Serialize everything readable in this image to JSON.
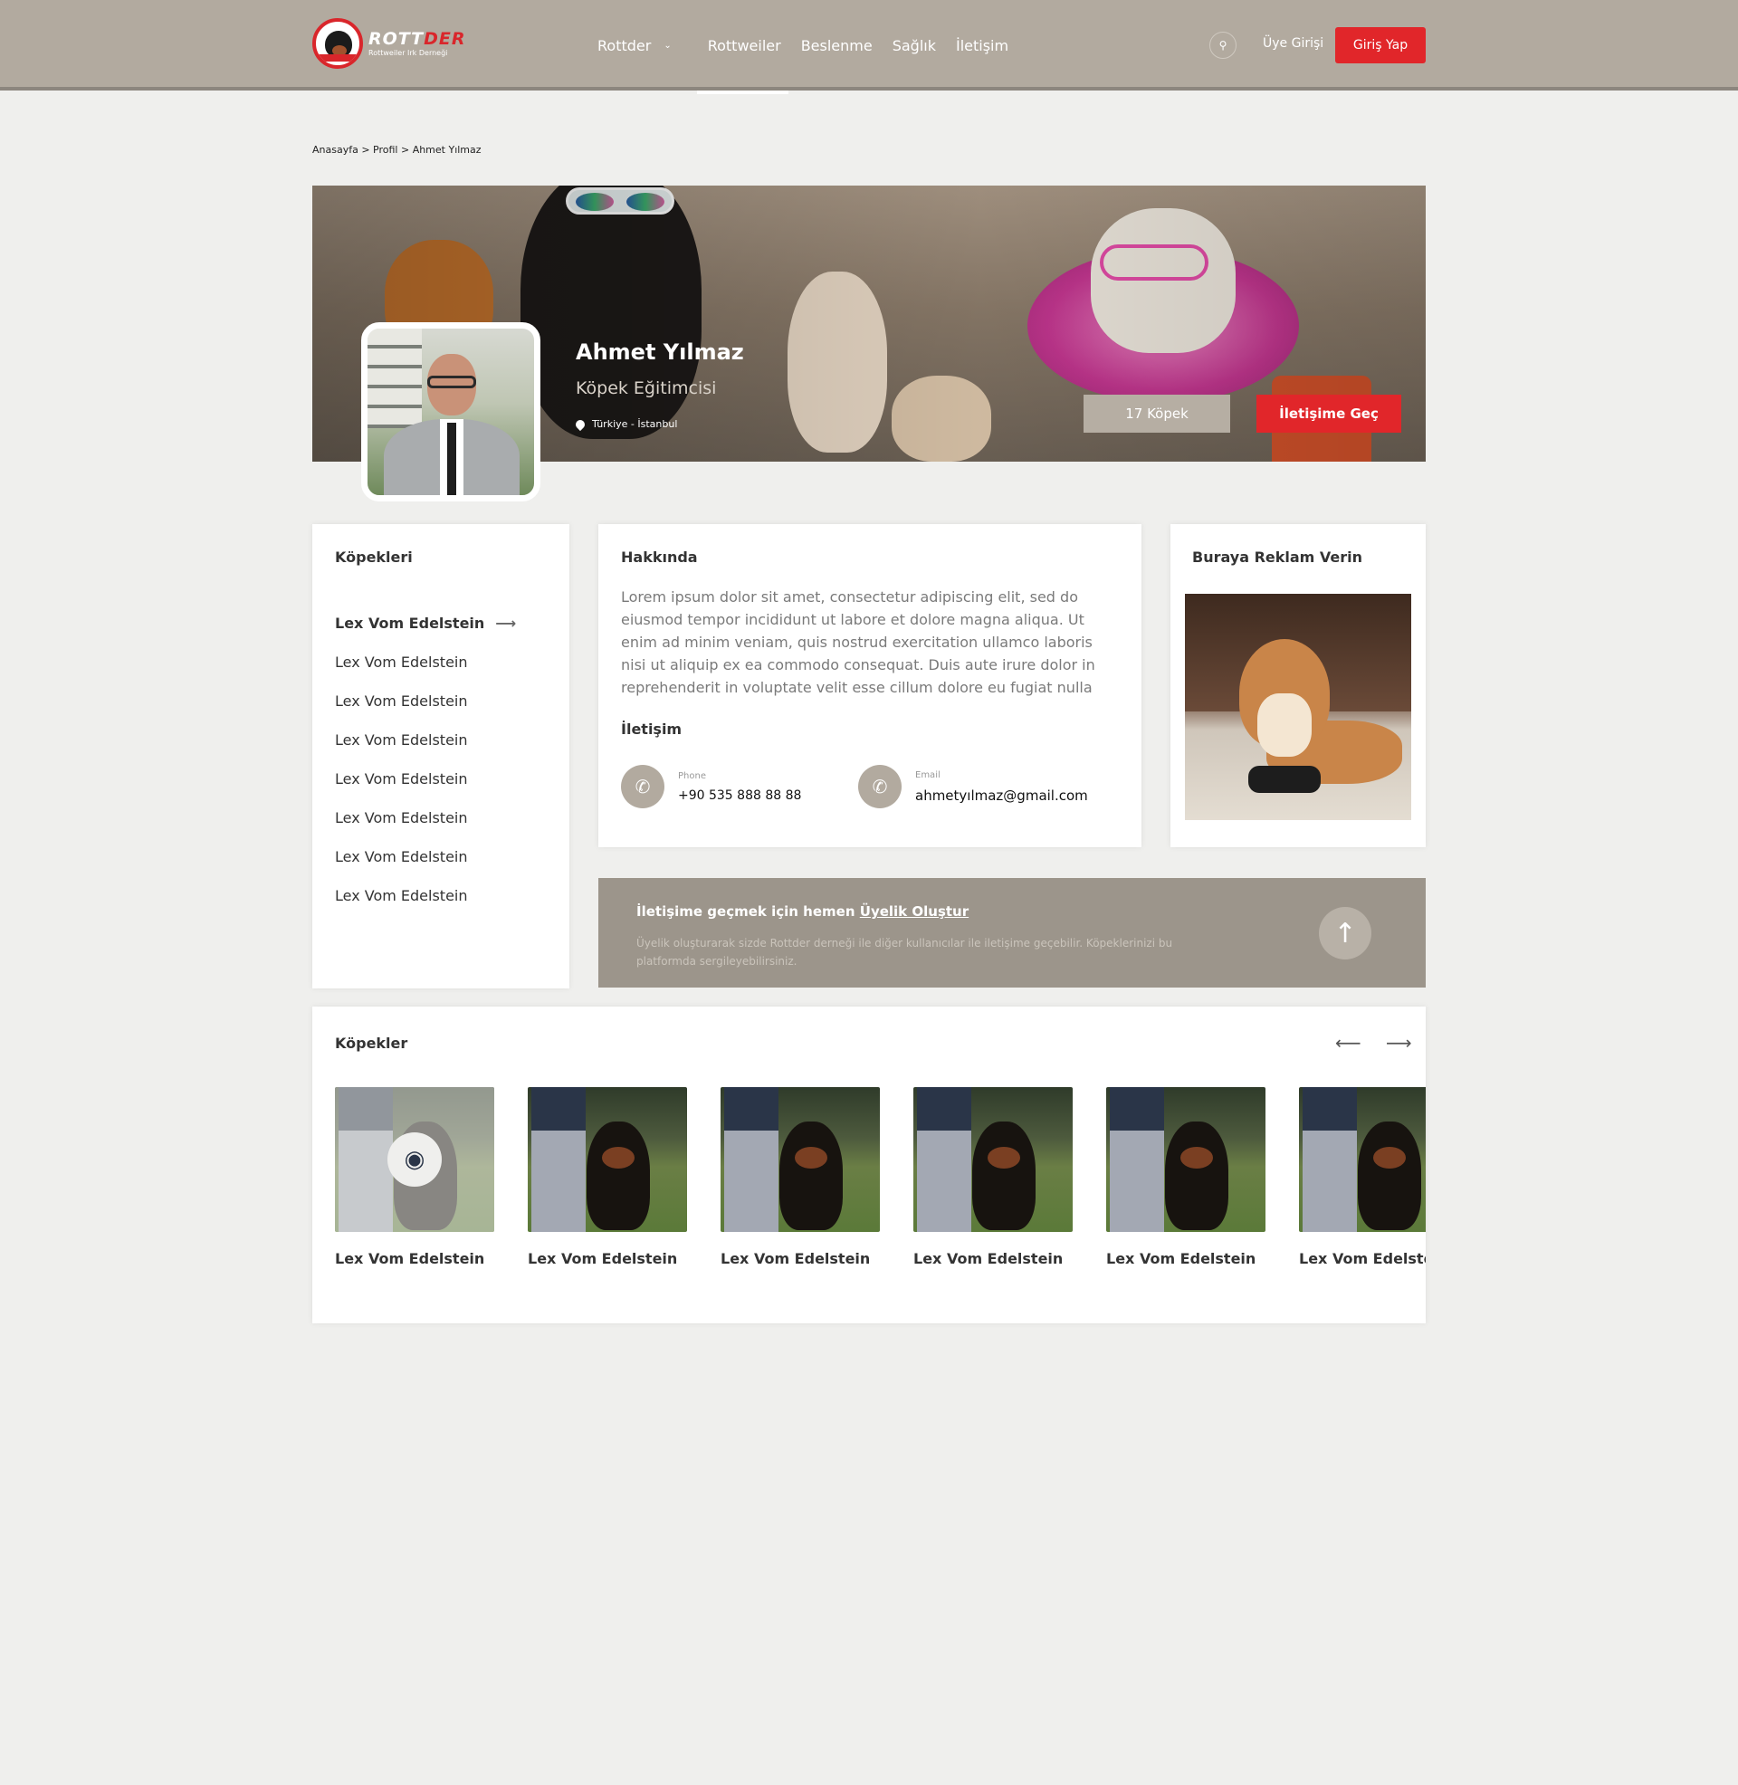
{
  "header": {
    "logo_name_a": "ROTT",
    "logo_name_b": "DER",
    "logo_sub": "Rottweiler Irk Derneği",
    "nav": [
      {
        "label": "Rottder",
        "chevron": "chevron-down-icon"
      },
      {
        "label": "Rottweiler"
      },
      {
        "label": "Beslenme"
      },
      {
        "label": "Sağlık"
      },
      {
        "label": "İletişim"
      }
    ],
    "active_nav": "Rottweiler",
    "search_icon": "search-icon",
    "member_login": "Üye Girişi",
    "login_button": "Giriş Yap"
  },
  "breadcrumb": "Anasayfa > Profil > Ahmet Yılmaz",
  "profile": {
    "name": "Ahmet Yılmaz",
    "title": "Köpek Eğitimcisi",
    "location": "Türkiye - İstanbul",
    "dogs_count_button": "17 Köpek",
    "contact_button": "İletişime Geç"
  },
  "dogs_list": {
    "title": "Köpekleri",
    "items": [
      "Lex Vom Edelstein",
      "Lex Vom Edelstein",
      "Lex Vom Edelstein",
      "Lex Vom Edelstein",
      "Lex Vom Edelstein",
      "Lex Vom Edelstein",
      "Lex Vom Edelstein",
      "Lex Vom Edelstein"
    ],
    "active_arrow": "⟶"
  },
  "about": {
    "title": "Hakkında",
    "text": "Lorem ipsum dolor sit amet, consectetur adipiscing elit, sed do eiusmod tempor incididunt ut labore et dolore magna aliqua. Ut enim ad minim veniam, quis nostrud exercitation ullamco laboris nisi ut aliquip ex ea commodo consequat. Duis aute irure dolor in reprehenderit in voluptate velit esse cillum dolore eu fugiat nulla",
    "contact_title": "İletişim",
    "phone_label": "Phone",
    "phone_value": "+90 535 888 88 88",
    "email_label": "Email",
    "email_value": "ahmetyılmaz@gmail.com"
  },
  "ad": {
    "title": "Buraya Reklam Verin"
  },
  "cta": {
    "title_prefix": "İletişime geçmek için hemen",
    "title_link": "Üyelik Oluştur",
    "text": "Üyelik oluşturarak sizde Rottder derneği ile diğer kullanıcılar ile iletişime geçebilir. Köpeklerinizi bu platformda sergileyebilirsiniz."
  },
  "gallery": {
    "title": "Köpekler",
    "prev": "⟵",
    "next": "⟶",
    "items": [
      {
        "name": "Lex Vom Edelstein",
        "hover": true
      },
      {
        "name": "Lex Vom Edelstein"
      },
      {
        "name": "Lex Vom Edelstein"
      },
      {
        "name": "Lex Vom Edelstein"
      },
      {
        "name": "Lex Vom Edelstein"
      },
      {
        "name": "Lex Vom Edelstein"
      }
    ]
  },
  "colors": {
    "header_bg": "#b2aa9f",
    "accent_red": "#e1262a",
    "cta_bg": "#9c958b",
    "page_bg": "#efefed"
  }
}
